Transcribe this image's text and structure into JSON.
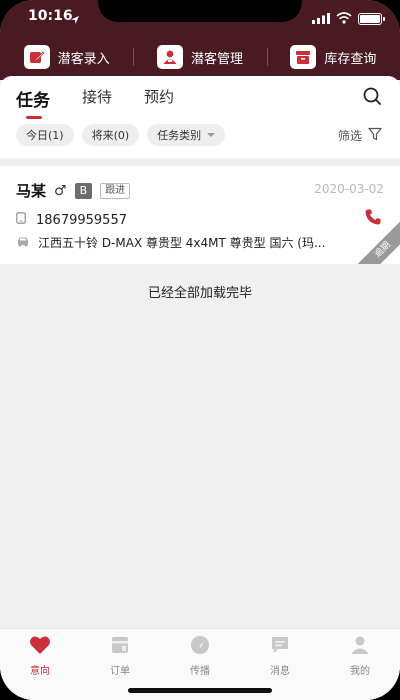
{
  "status": {
    "time": "10:16"
  },
  "quick_actions": [
    {
      "label": "潜客录入",
      "icon": "edit-icon"
    },
    {
      "label": "潜客管理",
      "icon": "person-icon"
    },
    {
      "label": "库存查询",
      "icon": "inventory-icon"
    }
  ],
  "tabs": [
    {
      "label": "任务",
      "active": true
    },
    {
      "label": "接待",
      "active": false
    },
    {
      "label": "预约",
      "active": false
    }
  ],
  "filters": {
    "today": "今日(1)",
    "future": "将来(0)",
    "task_type": "任务类别",
    "filter_label": "筛选"
  },
  "task_card": {
    "name": "马某",
    "gender_symbol": "♂",
    "grade": "B",
    "stage": "跟进",
    "date": "2020-03-02",
    "phone": "18679959557",
    "car": "江西五十铃 D-MAX 尊贵型 4x4MT 尊贵型 国六 (玛...",
    "overdue": "逾期"
  },
  "list_end_text": "已经全部加载完毕",
  "bottom_nav": [
    {
      "label": "意向",
      "icon": "heart-icon",
      "active": true
    },
    {
      "label": "订单",
      "icon": "order-icon",
      "active": false
    },
    {
      "label": "传播",
      "icon": "share-icon",
      "active": false
    },
    {
      "label": "消息",
      "icon": "message-icon",
      "active": false
    },
    {
      "label": "我的",
      "icon": "profile-icon",
      "active": false
    }
  ],
  "colors": {
    "header": "#4a1a23",
    "accent": "#c9303a"
  }
}
